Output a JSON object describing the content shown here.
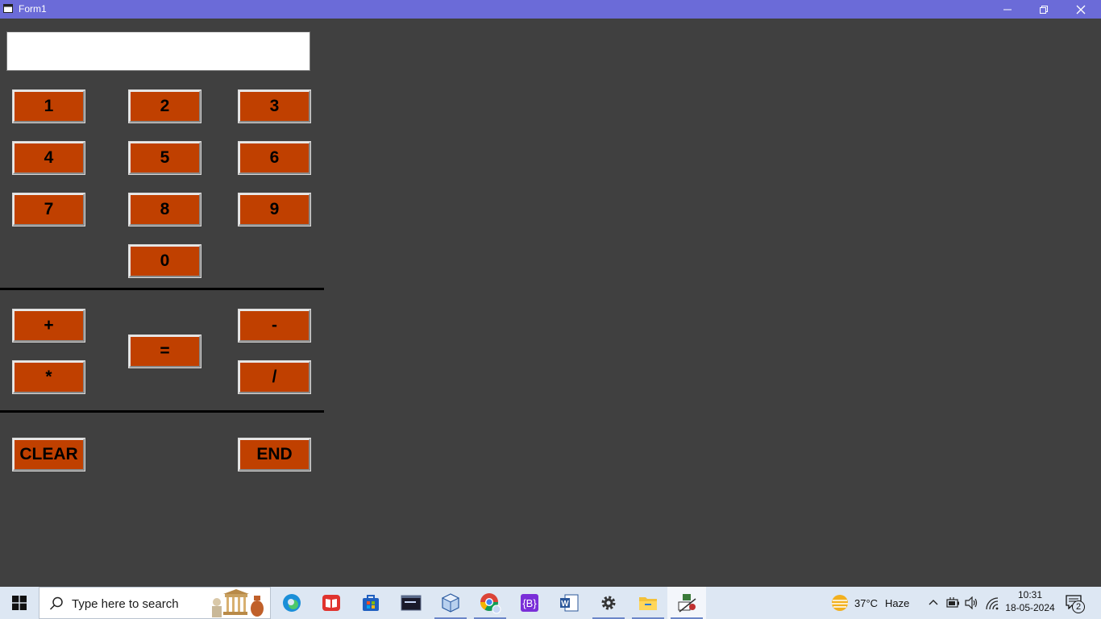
{
  "window": {
    "title": "Form1",
    "colors": {
      "titlebar": "#6b6bd8",
      "background": "#404040",
      "button": "#c04000"
    }
  },
  "display": {
    "value": ""
  },
  "digits": {
    "one": "1",
    "two": "2",
    "three": "3",
    "four": "4",
    "five": "5",
    "six": "6",
    "seven": "7",
    "eight": "8",
    "nine": "9",
    "zero": "0"
  },
  "operators": {
    "plus": "+",
    "minus": "-",
    "multiply": "*",
    "divide": "/",
    "equals": "="
  },
  "actions": {
    "clear": "CLEAR",
    "end": "END"
  },
  "taskbar": {
    "search_placeholder": "Type here to search",
    "apps": [
      "edge-icon",
      "reader-icon",
      "store-icon",
      "terminal-icon",
      "virtualbox-icon",
      "chrome-icon",
      "bootstrap-studio-icon",
      "word-icon",
      "settings-icon",
      "file-explorer-icon",
      "vb6-icon"
    ],
    "weather": {
      "temperature": "37°C",
      "condition": "Haze"
    },
    "clock": {
      "time": "10:31",
      "date": "18-05-2024"
    },
    "notifications": "2"
  }
}
